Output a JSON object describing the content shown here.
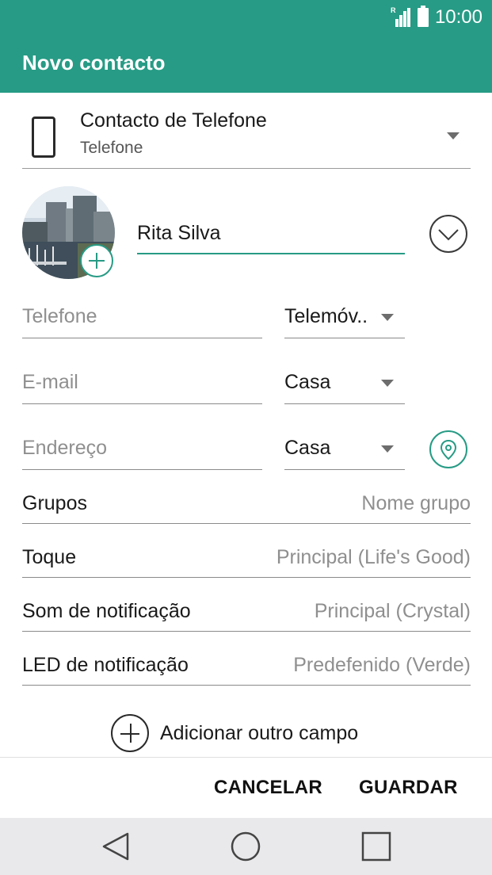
{
  "status_bar": {
    "time": "10:00",
    "roaming_indicator": "R",
    "icons": [
      "signal-icon",
      "battery-icon"
    ]
  },
  "app_bar": {
    "title": "Novo contacto"
  },
  "account": {
    "title": "Contacto de Telefone",
    "subtitle": "Telefone",
    "icon": "phone-icon"
  },
  "contact": {
    "name": "Rita Silva",
    "photo_icon": "add-photo-icon",
    "expand_icon": "chevron-down-icon"
  },
  "fields": {
    "phone": {
      "placeholder": "Telefone",
      "type": "Telemóv.."
    },
    "email": {
      "placeholder": "E-mail",
      "type": "Casa"
    },
    "address": {
      "placeholder": "Endereço",
      "type": "Casa",
      "icon": "location-pin-icon"
    }
  },
  "settings": [
    {
      "label": "Grupos",
      "value": "Nome grupo"
    },
    {
      "label": "Toque",
      "value": "Principal (Life's Good)"
    },
    {
      "label": "Som de notificação",
      "value": "Principal (Crystal)"
    },
    {
      "label": "LED de notificação",
      "value": "Predefenido (Verde)"
    }
  ],
  "add_field": {
    "label": "Adicionar outro campo",
    "icon": "add-circle-icon"
  },
  "actions": {
    "cancel": "CANCELAR",
    "save": "GUARDAR"
  },
  "nav": {
    "icons": [
      "back-icon",
      "home-icon",
      "recents-icon"
    ]
  },
  "colors": {
    "accent": "#279b85",
    "nav_background": "#e9e9ec"
  }
}
